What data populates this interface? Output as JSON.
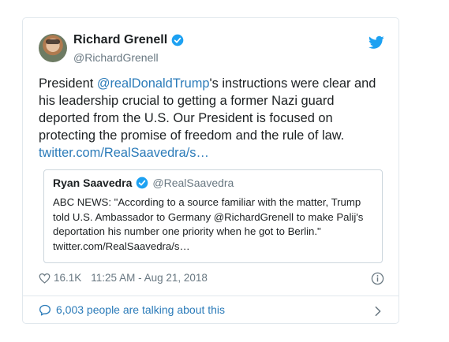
{
  "author": {
    "name": "Richard Grenell",
    "handle": "@RichardGrenell"
  },
  "tweet": {
    "text_before": "President ",
    "mention": "@realDonaldTrump",
    "text_after": "'s instructions were clear and his leadership crucial to getting a former Nazi guard deported from the U.S. Our President is focused on protecting the promise of freedom and the rule of law.",
    "link": "twitter.com/RealSaavedra/s…"
  },
  "quoted_tweet": {
    "name": "Ryan Saavedra",
    "handle": "@RealSaavedra",
    "text": "ABC NEWS: \"According to a source familiar with the matter, Trump told U.S. Ambassador to Germany @RichardGrenell to make Palij's deportation his number one priority when he got to Berlin.\" twitter.com/RealSaavedra/s…"
  },
  "meta": {
    "likes": "16.1K",
    "timestamp": "11:25 AM - Aug 21, 2018"
  },
  "footer": {
    "talking": "6,003 people are talking about this"
  },
  "icons": {
    "verified": "verified-badge-icon",
    "bird": "twitter-bird-icon",
    "heart": "heart-icon",
    "info": "info-icon",
    "bubble": "chat-bubble-icon",
    "chevron": "chevron-right-icon"
  },
  "colors": {
    "link": "#2b7bb9",
    "twitter_blue": "#1da1f2",
    "muted": "#697882",
    "border": "#e1e8ed"
  }
}
